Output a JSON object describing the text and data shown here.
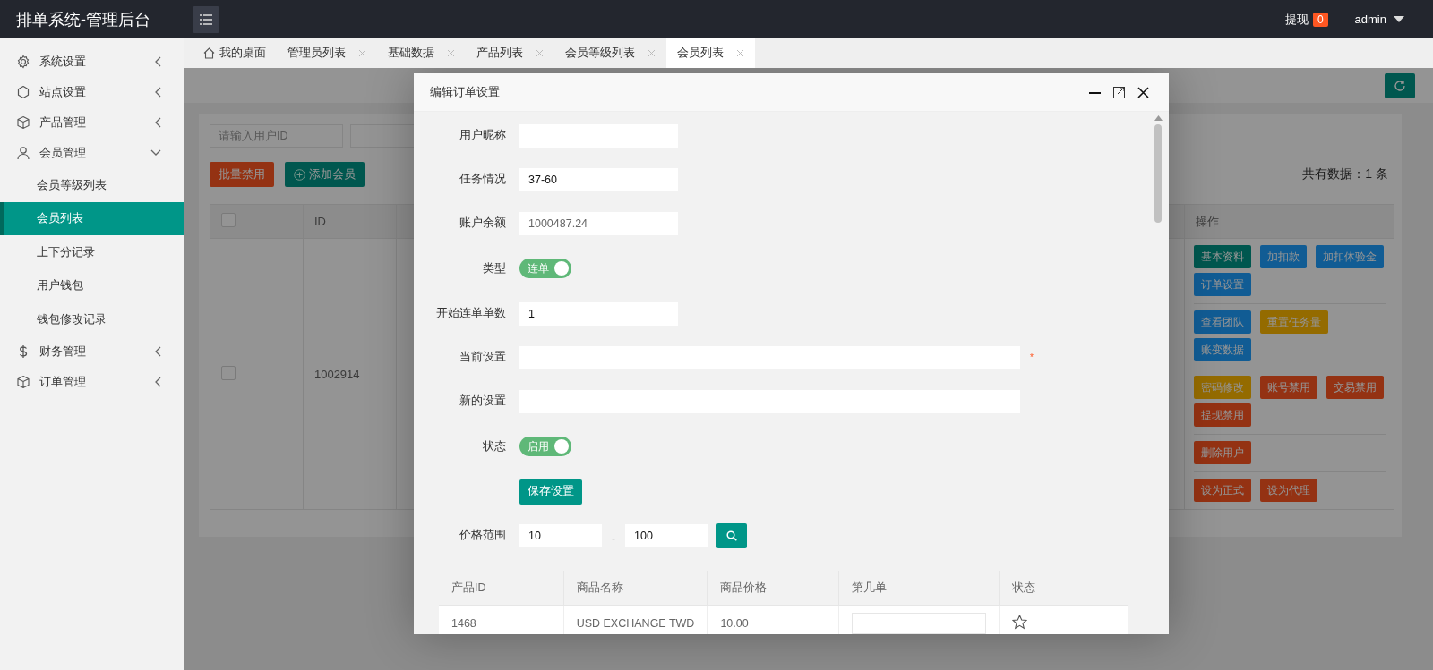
{
  "header": {
    "title": "排单系统-管理后台",
    "withdraw_label": "提现",
    "withdraw_count": "0",
    "user": "admin"
  },
  "sidebar": {
    "items": [
      {
        "label": "系统设置",
        "kind": "gear",
        "expanded": false
      },
      {
        "label": "站点设置",
        "kind": "shape",
        "expanded": false
      },
      {
        "label": "产品管理",
        "kind": "box",
        "expanded": false
      },
      {
        "label": "会员管理",
        "kind": "user",
        "expanded": true,
        "children": [
          {
            "label": "会员等级列表",
            "selected": false
          },
          {
            "label": "会员列表",
            "selected": true
          },
          {
            "label": "上下分记录",
            "selected": false
          },
          {
            "label": "用户钱包",
            "selected": false
          },
          {
            "label": "钱包修改记录",
            "selected": false
          }
        ]
      },
      {
        "label": "财务管理",
        "kind": "dollar",
        "expanded": false
      },
      {
        "label": "订单管理",
        "kind": "box",
        "expanded": false
      }
    ]
  },
  "tabs": [
    {
      "label": "我的桌面",
      "kind": "home",
      "selected": false
    },
    {
      "label": "管理员列表",
      "kind": "closable",
      "selected": false
    },
    {
      "label": "基础数据",
      "kind": "closable",
      "selected": false
    },
    {
      "label": "产品列表",
      "kind": "closable",
      "selected": false
    },
    {
      "label": "会员等级列表",
      "kind": "closable",
      "selected": false
    },
    {
      "label": "会员列表",
      "kind": "closable",
      "selected": true
    }
  ],
  "page": {
    "search_placeholder": "请输入用户ID",
    "buttons": [
      {
        "label": "批量禁用",
        "kind": "danger"
      },
      {
        "label": "添加会员",
        "kind": "add"
      }
    ],
    "total": "共有数据：1 条",
    "columns": [
      {
        "kind": "check",
        "checked": false
      },
      {
        "kind": "text",
        "label": "ID"
      },
      {
        "kind": "blank"
      },
      {
        "kind": "text",
        "label": "操作"
      }
    ],
    "rows": [
      {
        "checked": false,
        "id": "1002914",
        "actions": [
          [
            {
              "label": "基本资料",
              "kind": "primary"
            },
            {
              "label": "加扣款",
              "kind": "normal"
            },
            {
              "label": "加扣体验金",
              "kind": "normal"
            },
            {
              "label": "订单设置",
              "kind": "normal"
            }
          ],
          [
            {
              "label": "查看团队",
              "kind": "normal"
            },
            {
              "label": "重置任务量",
              "kind": "warm"
            },
            {
              "label": "账变数据",
              "kind": "normal"
            }
          ],
          [
            {
              "label": "密码修改",
              "kind": "warm"
            },
            {
              "label": "账号禁用",
              "kind": "danger"
            },
            {
              "label": "交易禁用",
              "kind": "danger"
            },
            {
              "label": "提现禁用",
              "kind": "danger"
            }
          ],
          [
            {
              "label": "删除用户",
              "kind": "danger"
            }
          ],
          [
            {
              "label": "设为正式",
              "kind": "danger"
            },
            {
              "label": "设为代理",
              "kind": "danger"
            }
          ]
        ]
      }
    ]
  },
  "dialog": {
    "title": "编辑订单设置",
    "fields": [
      {
        "kind": "text",
        "label": "用户昵称"
      },
      {
        "kind": "text",
        "label": "任务情况",
        "value": "37-60",
        "readonly": false
      },
      {
        "kind": "text",
        "label": "账户余额",
        "value": "1000487.24",
        "readonly": true
      },
      {
        "kind": "switch",
        "label": "类型",
        "text": "连单",
        "on": true
      },
      {
        "kind": "text",
        "label": "开始连单单数",
        "value": "1",
        "readonly": false
      },
      {
        "kind": "wide",
        "label": "当前设置",
        "required_mark": "*"
      },
      {
        "kind": "wide",
        "label": "新的设置"
      },
      {
        "kind": "switch",
        "label": "状态",
        "text": "启用",
        "on": true
      },
      {
        "kind": "button",
        "label": "保存设置"
      },
      {
        "kind": "range",
        "label": "价格范围",
        "min": "10",
        "separator": "-",
        "max": "100"
      }
    ],
    "table": {
      "columns": [
        "产品ID",
        "商品名称",
        "商品价格",
        "第几单",
        "状态"
      ],
      "rows": [
        {
          "id": "1468",
          "name": "USD EXCHANGE TWD",
          "price": "10.00",
          "starred": false
        }
      ]
    }
  }
}
